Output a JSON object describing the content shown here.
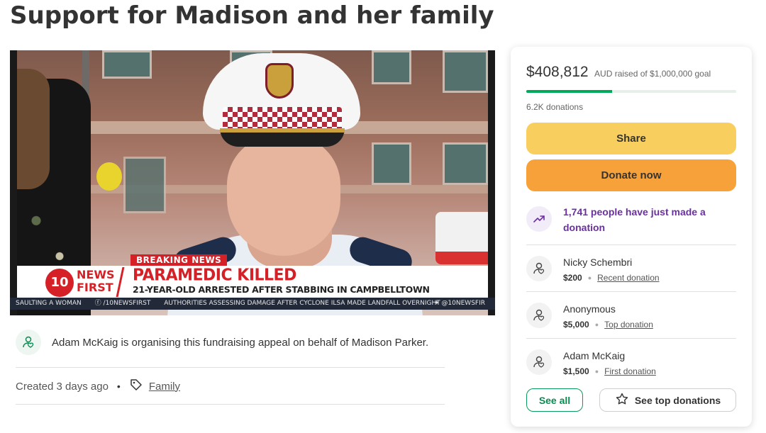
{
  "page": {
    "title": "Support for Madison and her family"
  },
  "hero": {
    "breaking_tag": "BREAKING NEWS",
    "logo_number": "10",
    "logo_news_line1": "NEWS",
    "logo_news_line2": "FIRST",
    "headline": "PARAMEDIC KILLED",
    "subheadline": "21-YEAR-OLD ARRESTED AFTER STABBING IN CAMPBELLTOWN",
    "ticker_left": "SAULTING A WOMAN",
    "ticker_social": "/10NEWSFIRST",
    "ticker_main": "AUTHORITIES ASSESSING DAMAGE AFTER CYCLONE ILSA MADE LANDFALL OVERNIGHT",
    "ticker_right": "@10NEWSFIR"
  },
  "organiser": {
    "text": "Adam McKaig is organising this fundraising appeal on behalf of Madison Parker.",
    "created": "Created 3 days ago",
    "bullet": "•",
    "category": "Family"
  },
  "card": {
    "raised_amount": "$408,812",
    "raised_goal_text": "AUD raised of $1,000,000 goal",
    "progress_fraction": 0.408812,
    "donations_count": "6.2K donations",
    "share_label": "Share",
    "donate_label": "Donate now",
    "activity_text": "1,741 people have just made a donation",
    "donors": [
      {
        "name": "Nicky Schembri",
        "amount": "$200",
        "type": "Recent donation"
      },
      {
        "name": "Anonymous",
        "amount": "$5,000",
        "type": "Top donation"
      },
      {
        "name": "Adam McKaig",
        "amount": "$1,500",
        "type": "First donation"
      }
    ],
    "see_all_label": "See all",
    "see_top_label": "See top donations"
  },
  "colors": {
    "progress": "#02a95c",
    "share": "#f8cf5f",
    "donate": "#f7a13a",
    "activity": "#6b2fa0",
    "news_red": "#d62027"
  },
  "icons": {
    "organiser_avatar": "user-heart-icon",
    "activity": "trending-up-icon",
    "donor_avatar": "user-heart-icon",
    "tag": "tag-icon",
    "star": "star-icon"
  }
}
